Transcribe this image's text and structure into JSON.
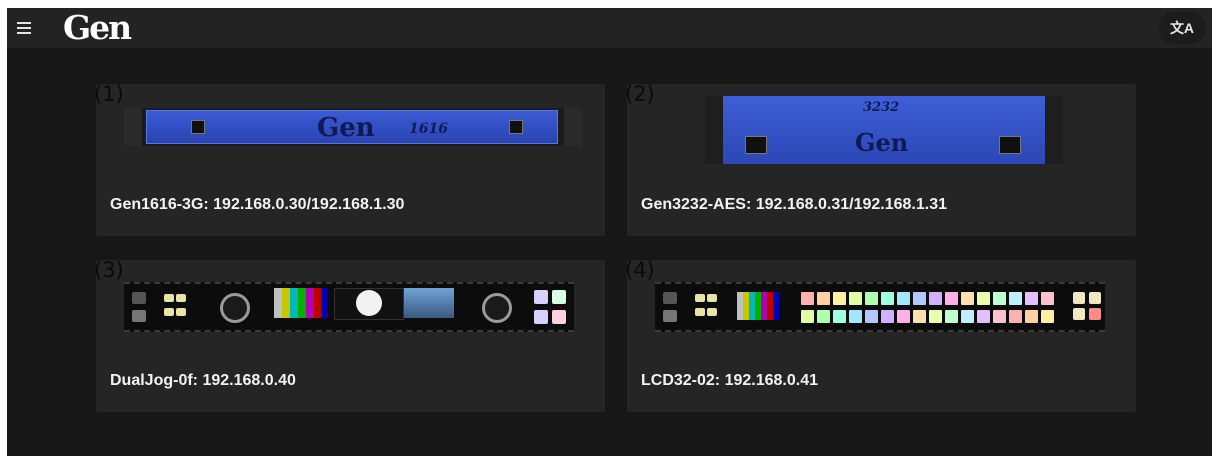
{
  "header": {
    "logo_text": "Gen",
    "menu_icon": "hamburger-menu-icon",
    "translate_icon": "translate-icon",
    "translate_glyph": "文A"
  },
  "devices": [
    {
      "number": "(1)",
      "title": "Gen1616-3G: 192.168.0.30/192.168.1.30",
      "image_logo": "Gen",
      "image_model": "1616"
    },
    {
      "number": "(2)",
      "title": "Gen3232-AES: 192.168.0.31/192.168.1.31",
      "image_logo": "Gen",
      "image_model": "3232"
    },
    {
      "number": "(3)",
      "title": "DualJog-0f: 192.168.0.40"
    },
    {
      "number": "(4)",
      "title": "LCD32-02: 192.168.0.41"
    }
  ],
  "colors": {
    "background": "#171717",
    "topbar": "#232323",
    "card": "#252525",
    "device_blue": "#3356cc"
  }
}
